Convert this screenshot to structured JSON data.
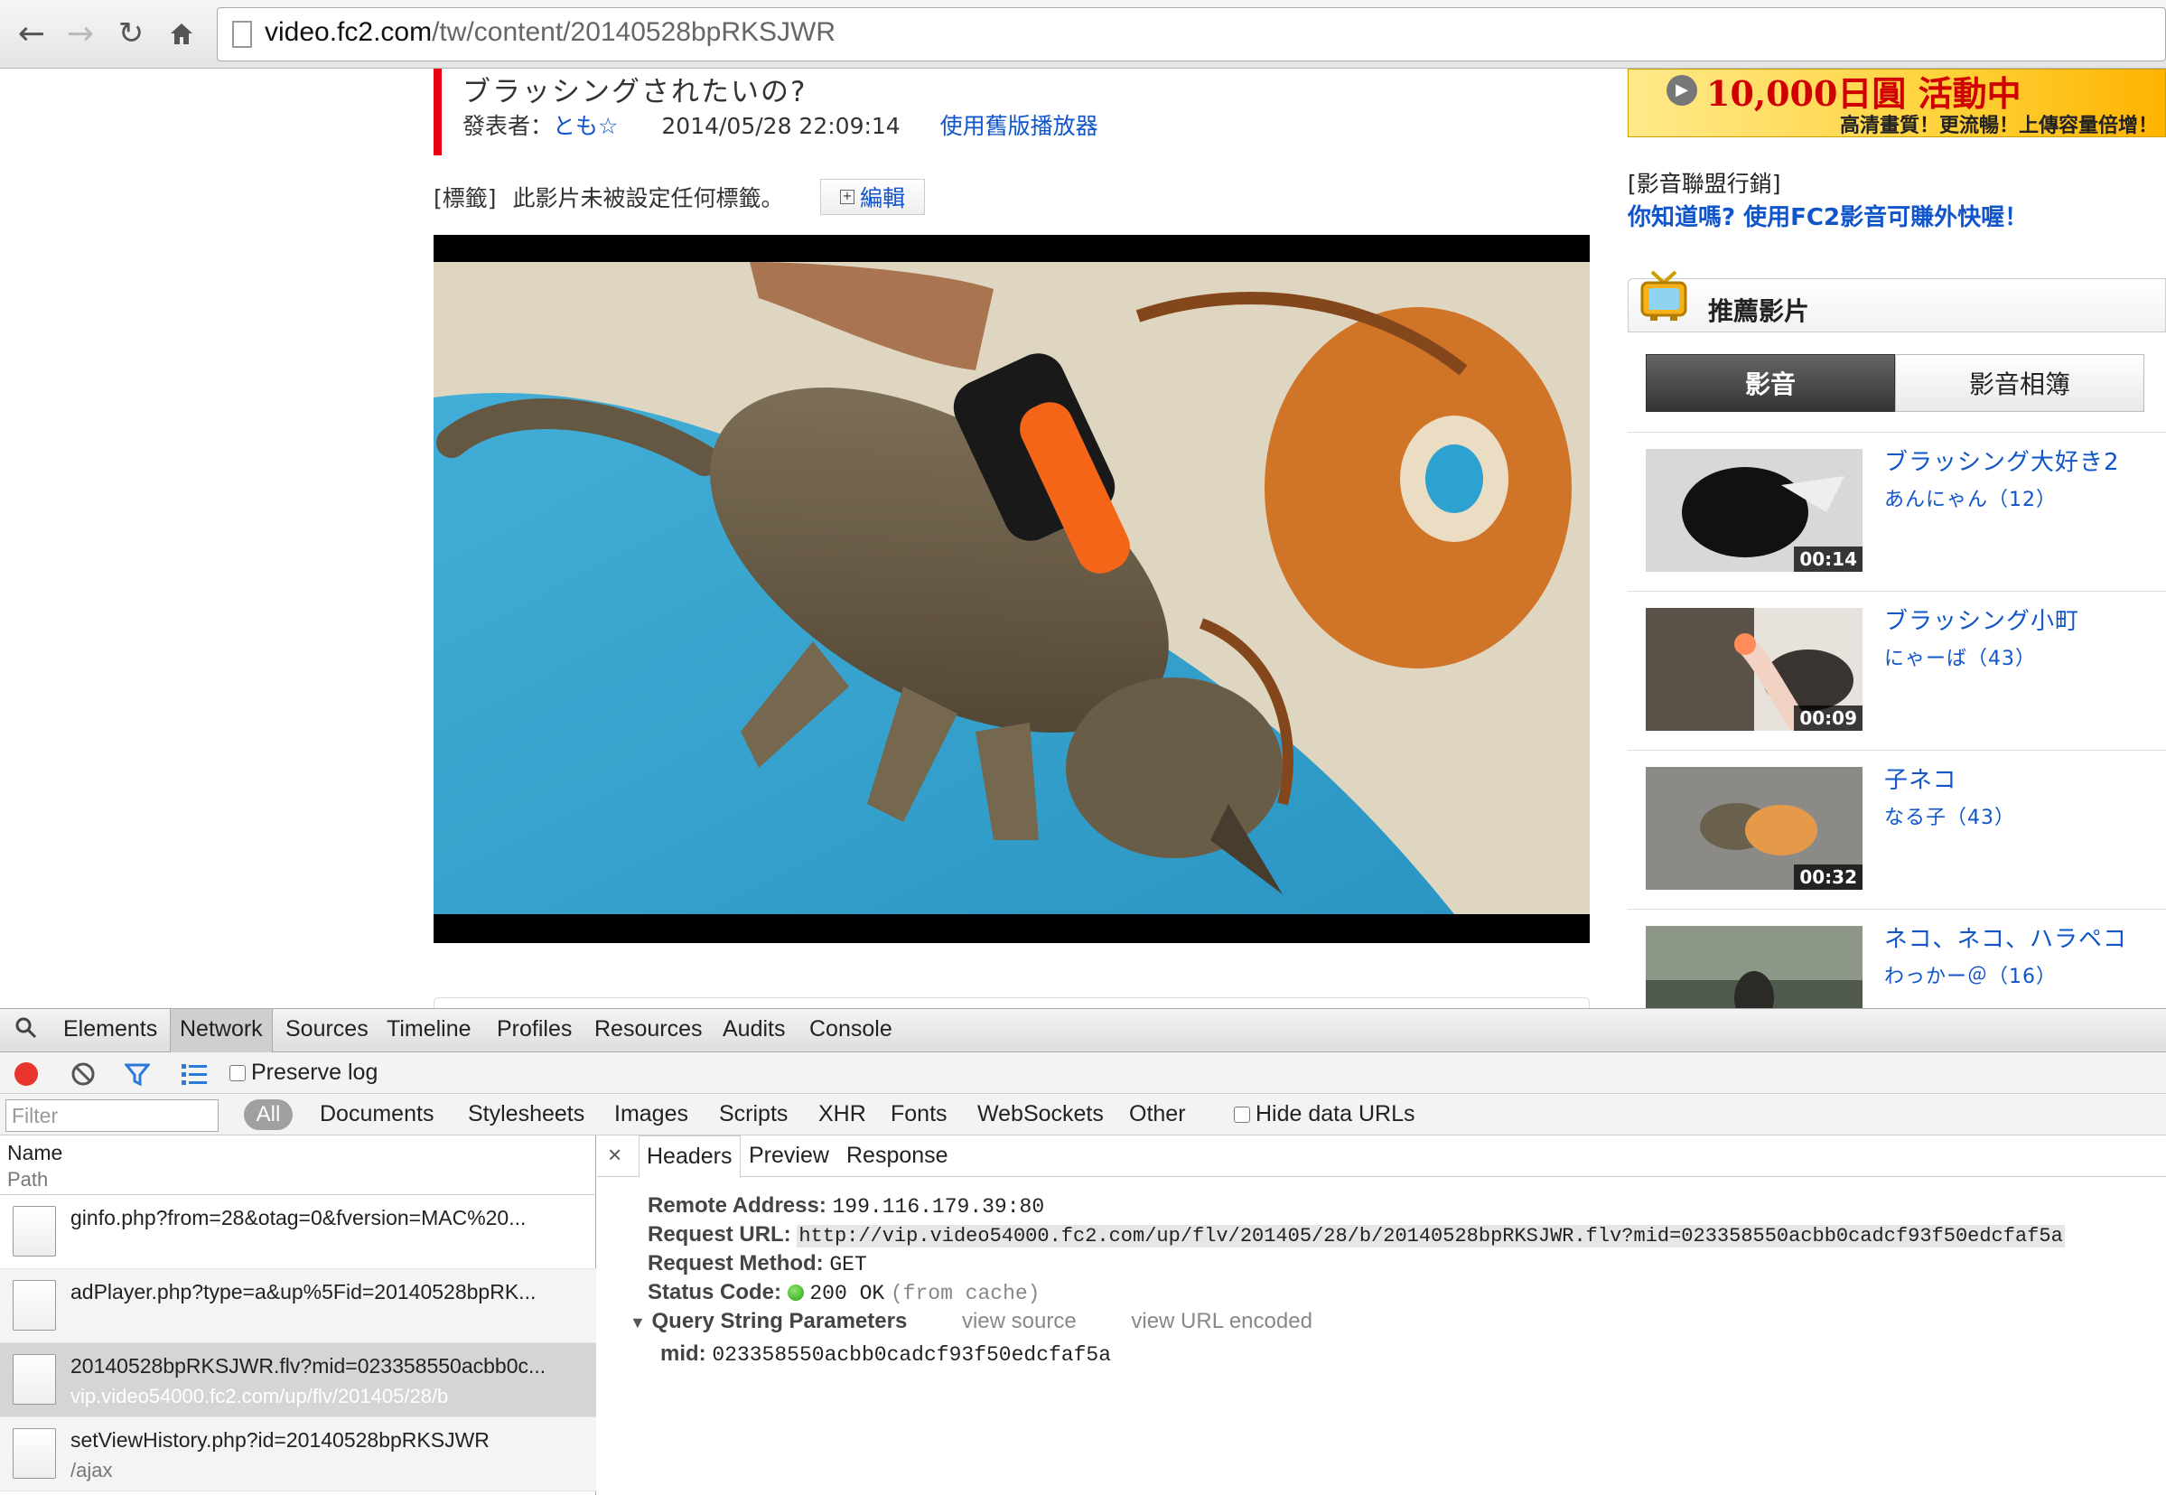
{
  "browser": {
    "url_host": "video.fc2.com",
    "url_path": "/tw/content/20140528bpRKSJWR"
  },
  "video": {
    "title": "ブラッシングされたいの?",
    "publisher_label": "發表者：",
    "publisher_name": "とも☆",
    "date": "2014/05/28 22:09:14",
    "old_player_link": "使用舊版播放器",
    "tags_label": "[標籤]",
    "tags_text": "此影片未被設定任何標籤。",
    "edit_button": "編輯"
  },
  "sidebar": {
    "ad_headline": "10,000日圓 活動中",
    "ad_subline": "高清畫質！更流暢！上傳容量倍增！",
    "affiliate_label": "[影音聯盟行銷]",
    "affiliate_link": "你知道嗎? 使用FC2影音可賺外快喔！",
    "recommended_title": "推薦影片",
    "tabs": [
      "影音",
      "影音相簿"
    ],
    "videos": [
      {
        "title": "ブラッシング大好き2",
        "user": "あんにゃん（12）",
        "duration": "00:14"
      },
      {
        "title": "ブラッシング小町",
        "user": "にゃーば（43）",
        "duration": "00:09"
      },
      {
        "title": "子ネコ",
        "user": "なる子（43）",
        "duration": "00:32"
      },
      {
        "title": "ネコ、ネコ、ハラペコ",
        "user": "わっかー＠（16）",
        "duration": ""
      }
    ]
  },
  "devtools": {
    "tabs": [
      "Elements",
      "Network",
      "Sources",
      "Timeline",
      "Profiles",
      "Resources",
      "Audits",
      "Console"
    ],
    "preserve_log": "Preserve log",
    "filter_placeholder": "Filter",
    "filter_all": "All",
    "filter_types": [
      "Documents",
      "Stylesheets",
      "Images",
      "Scripts",
      "XHR",
      "Fonts",
      "WebSockets",
      "Other"
    ],
    "hide_data_urls": "Hide data URLs",
    "col_name": "Name",
    "col_path": "Path",
    "requests": [
      {
        "name": "ginfo.php?from=28&otag=0&fversion=MAC%20...",
        "path": ""
      },
      {
        "name": "adPlayer.php?type=a&up%5Fid=20140528bpRK...",
        "path": ""
      },
      {
        "name": "20140528bpRKSJWR.flv?mid=023358550acbb0c...",
        "path": "vip.video54000.fc2.com/up/flv/201405/28/b"
      },
      {
        "name": "setViewHistory.php?id=20140528bpRKSJWR",
        "path": "/ajax"
      }
    ],
    "detail_tabs": [
      "Headers",
      "Preview",
      "Response"
    ],
    "remote_address_label": "Remote Address:",
    "remote_address": "199.116.179.39:80",
    "request_url_label": "Request URL:",
    "request_url": "http://vip.video54000.fc2.com/up/flv/201405/28/b/20140528bpRKSJWR.flv?mid=023358550acbb0cadcf93f50edcfaf5a",
    "request_method_label": "Request Method:",
    "request_method": "GET",
    "status_code_label": "Status Code:",
    "status_code": "200 OK",
    "status_note": "(from cache)",
    "query_section": "Query String Parameters",
    "view_source": "view source",
    "view_url_encoded": "view URL encoded",
    "param_key": "mid:",
    "param_value": "023358550acbb0cadcf93f50edcfaf5a"
  }
}
